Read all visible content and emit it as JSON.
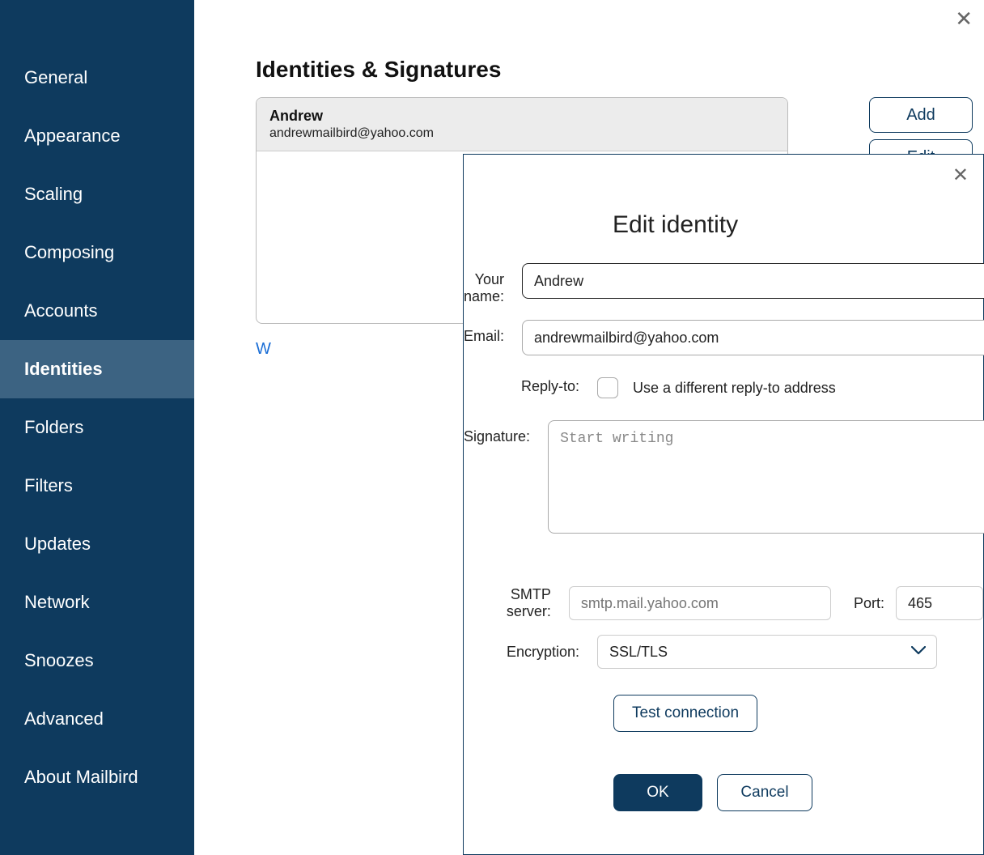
{
  "sidebar": {
    "items": [
      {
        "label": "General"
      },
      {
        "label": "Appearance"
      },
      {
        "label": "Scaling"
      },
      {
        "label": "Composing"
      },
      {
        "label": "Accounts"
      },
      {
        "label": "Identities"
      },
      {
        "label": "Folders"
      },
      {
        "label": "Filters"
      },
      {
        "label": "Updates"
      },
      {
        "label": "Network"
      },
      {
        "label": "Snoozes"
      },
      {
        "label": "Advanced"
      },
      {
        "label": "About Mailbird"
      }
    ],
    "active_index": 5
  },
  "page": {
    "title": "Identities & Signatures",
    "link_partial": "W"
  },
  "identity_list": {
    "selected": {
      "name": "Andrew",
      "email": "andrewmailbird@yahoo.com"
    }
  },
  "actions": {
    "add": "Add",
    "edit": "Edit"
  },
  "modal": {
    "title": "Edit identity",
    "labels": {
      "your_name": "Your name:",
      "email": "Email:",
      "reply_to": "Reply-to:",
      "signature": "Signature:",
      "smtp": "SMTP server:",
      "port": "Port:",
      "encryption": "Encryption:"
    },
    "values": {
      "your_name": "Andrew",
      "email": "andrewmailbird@yahoo.com",
      "reply_to_checked": false,
      "reply_to_label": "Use a different reply-to address",
      "signature_placeholder": "Start writing",
      "smtp_placeholder": "smtp.mail.yahoo.com",
      "smtp_value": "",
      "port": "465",
      "encryption": "SSL/TLS"
    },
    "buttons": {
      "test": "Test connection",
      "ok": "OK",
      "cancel": "Cancel"
    }
  }
}
